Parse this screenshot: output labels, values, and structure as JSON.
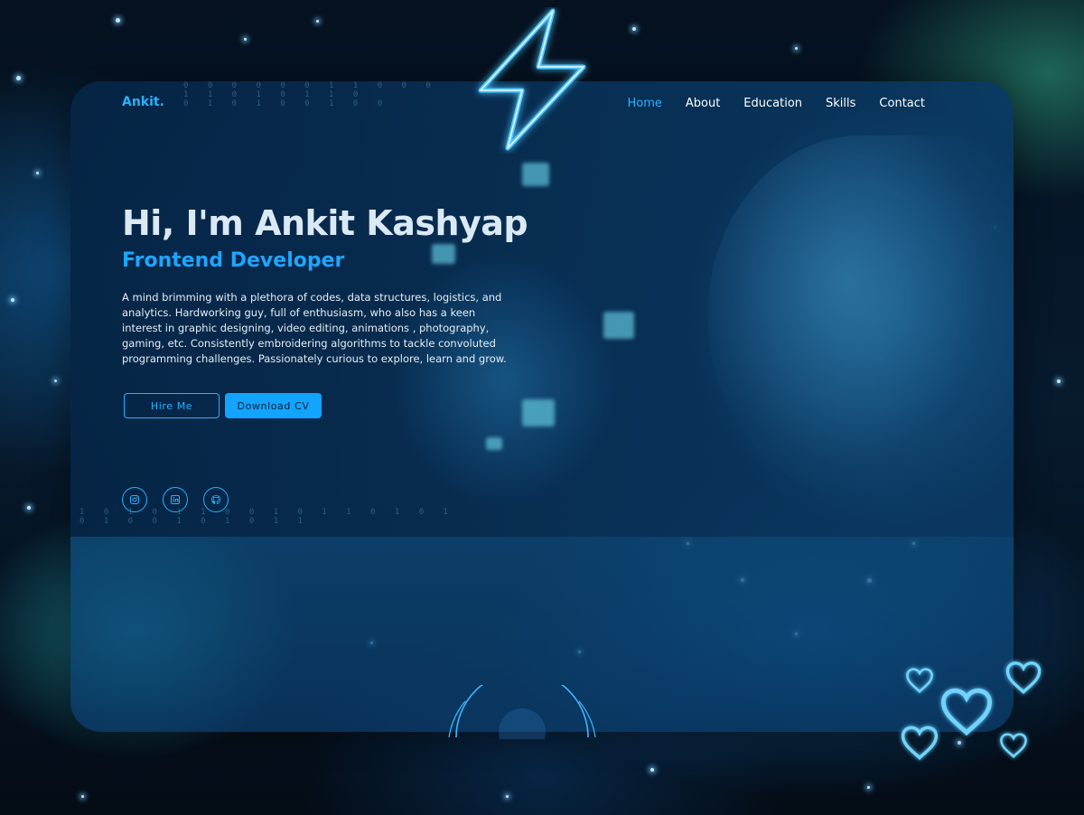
{
  "brand": {
    "logo_text": "Ankit."
  },
  "nav": {
    "items": [
      {
        "label": "Home",
        "active": true
      },
      {
        "label": "About",
        "active": false
      },
      {
        "label": "Education",
        "active": false
      },
      {
        "label": "Skills",
        "active": false
      },
      {
        "label": "Contact",
        "active": false
      }
    ]
  },
  "hero": {
    "title": "Hi, I'm Ankit Kashyap",
    "subtitle": "Frontend Developer",
    "bio": "A mind brimming with a plethora of codes, data structures, logistics, and analytics. Hardworking guy, full of enthusiasm, who also has a keen interest in graphic designing, video editing, animations , photography, gaming, etc. Consistently embroidering algorithms to tackle convoluted programming challenges. Passionately curious to explore, learn and grow.",
    "primary_button": "Hire Me",
    "secondary_button": "Download CV"
  },
  "social": [
    {
      "icon": "instagram-icon"
    },
    {
      "icon": "linkedin-icon"
    },
    {
      "icon": "github-icon"
    }
  ],
  "colors": {
    "accent": "#2ab0ff",
    "button_fill": "#12a4ff",
    "title": "#dbe9f5",
    "text": "#e6eef6"
  }
}
